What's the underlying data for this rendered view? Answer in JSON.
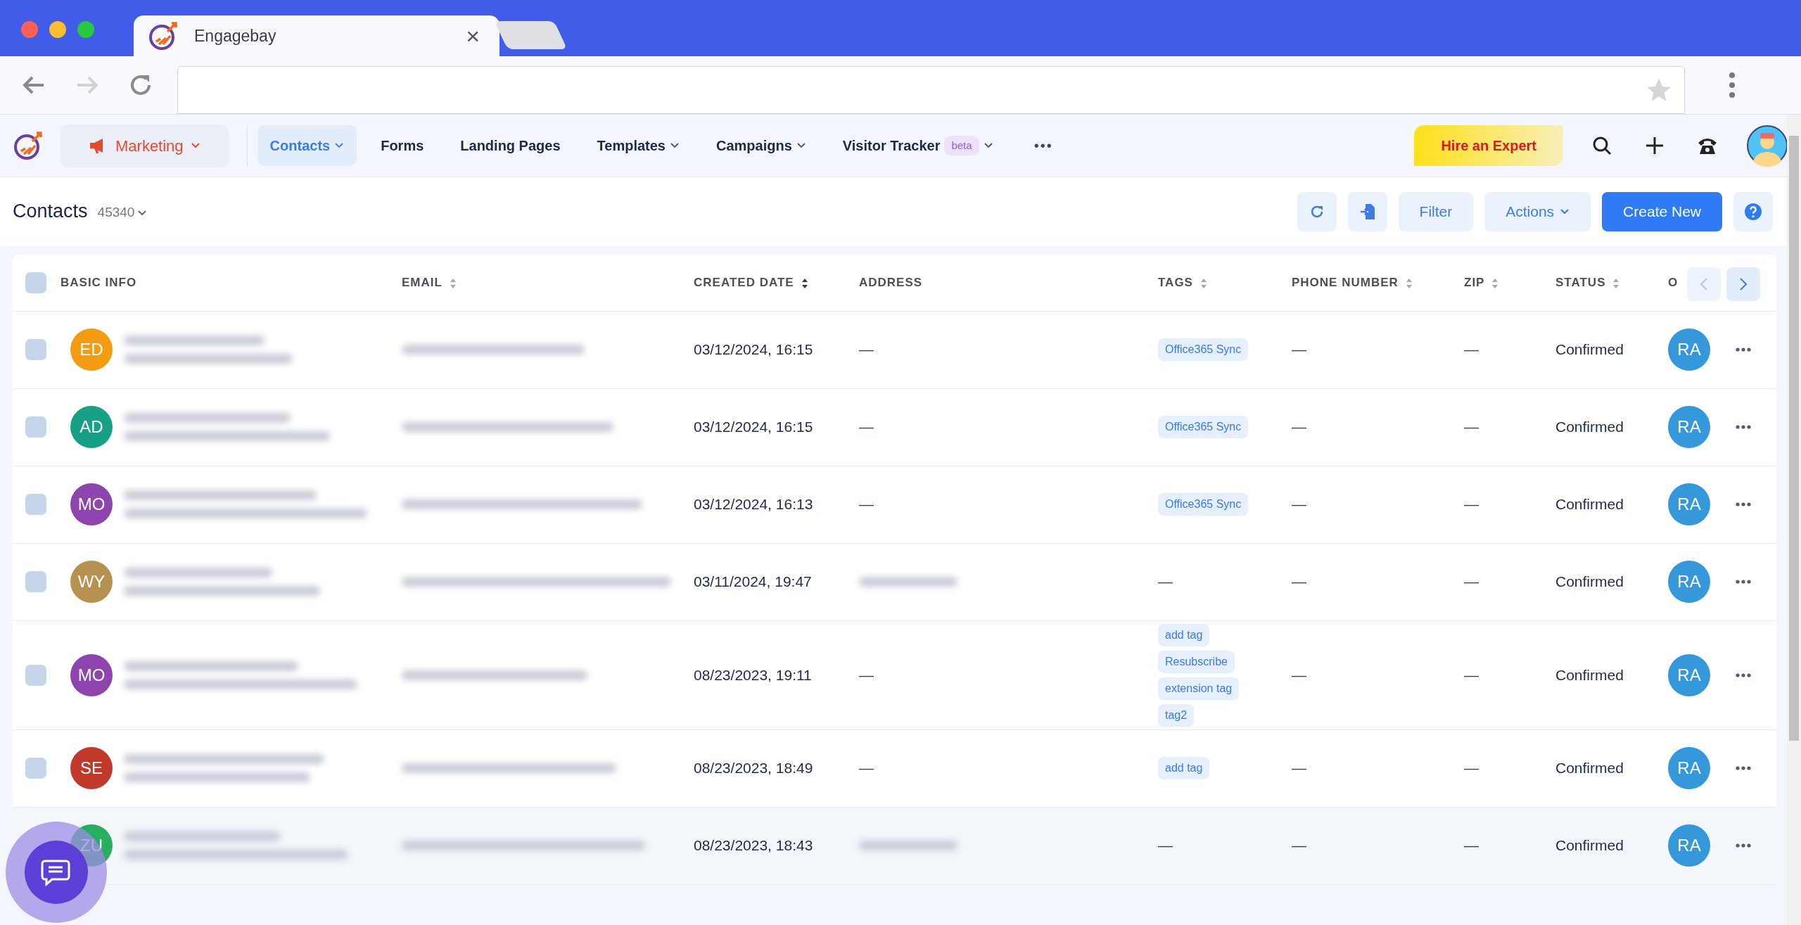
{
  "browser": {
    "tab_title": "Engagebay",
    "close": "×"
  },
  "app_nav": {
    "module": "Marketing",
    "items": [
      {
        "label": "Contacts",
        "selected": true,
        "dropdown": true
      },
      {
        "label": "Forms",
        "selected": false,
        "dropdown": false
      },
      {
        "label": "Landing Pages",
        "selected": false,
        "dropdown": false
      },
      {
        "label": "Templates",
        "selected": false,
        "dropdown": true
      },
      {
        "label": "Campaigns",
        "selected": false,
        "dropdown": true
      },
      {
        "label": "Visitor Tracker",
        "selected": false,
        "dropdown": true,
        "badge": "beta"
      }
    ],
    "more": "•••",
    "hire_button": "Hire an Expert"
  },
  "page": {
    "title": "Contacts",
    "count": "45340",
    "filter": "Filter",
    "actions": "Actions",
    "create": "Create New"
  },
  "table": {
    "select_all_checked": false,
    "columns": [
      {
        "label": "BASIC INFO",
        "sortable": false,
        "sorted": false
      },
      {
        "label": "EMAIL",
        "sortable": true,
        "sorted": false
      },
      {
        "label": "CREATED DATE",
        "sortable": true,
        "sorted": true
      },
      {
        "label": "ADDRESS",
        "sortable": false,
        "sorted": false
      },
      {
        "label": "TAGS",
        "sortable": true,
        "sorted": false
      },
      {
        "label": "PHONE NUMBER",
        "sortable": true,
        "sorted": false
      },
      {
        "label": "ZIP",
        "sortable": true,
        "sorted": false
      },
      {
        "label": "STATUS",
        "sortable": true,
        "sorted": false
      },
      {
        "label": "O",
        "sortable": false,
        "sorted": false
      }
    ],
    "rows": [
      {
        "checked": false,
        "highlighted": false,
        "initials": "ED",
        "color": "#f39c12",
        "created": "03/12/2024, 16:15",
        "address": "—",
        "address_blurred": false,
        "tags": [
          "Office365 Sync"
        ],
        "phone": "—",
        "zip": "—",
        "status": "Confirmed",
        "owner": "RA"
      },
      {
        "checked": false,
        "highlighted": false,
        "initials": "AD",
        "color": "#16a085",
        "created": "03/12/2024, 16:15",
        "address": "—",
        "address_blurred": false,
        "tags": [
          "Office365 Sync"
        ],
        "phone": "—",
        "zip": "—",
        "status": "Confirmed",
        "owner": "RA"
      },
      {
        "checked": false,
        "highlighted": false,
        "initials": "MO",
        "color": "#8e44ad",
        "created": "03/12/2024, 16:13",
        "address": "—",
        "address_blurred": false,
        "tags": [
          "Office365 Sync"
        ],
        "phone": "—",
        "zip": "—",
        "status": "Confirmed",
        "owner": "RA"
      },
      {
        "checked": false,
        "highlighted": false,
        "initials": "WY",
        "color": "#b7914f",
        "created": "03/11/2024, 19:47",
        "address_blurred": true,
        "tags_placeholder": "—",
        "phone": "—",
        "zip": "—",
        "status": "Confirmed",
        "owner": "RA"
      },
      {
        "checked": false,
        "highlighted": false,
        "initials": "MO",
        "color": "#8e44ad",
        "created": "08/23/2023, 19:11",
        "address": "—",
        "address_blurred": false,
        "tags": [
          "add tag",
          "Resubscribe",
          "extension tag",
          "tag2"
        ],
        "phone": "—",
        "zip": "—",
        "status": "Confirmed",
        "owner": "RA"
      },
      {
        "checked": false,
        "highlighted": false,
        "initials": "SE",
        "color": "#c0392b",
        "created": "08/23/2023, 18:49",
        "address": "—",
        "address_blurred": false,
        "tags": [
          "add tag"
        ],
        "phone": "—",
        "zip": "—",
        "status": "Confirmed",
        "owner": "RA"
      },
      {
        "highlighted": true,
        "initials": "ZU",
        "color": "#27ae60",
        "created": "08/23/2023, 18:43",
        "address_blurred": true,
        "tags_placeholder": "—",
        "phone": "—",
        "zip": "—",
        "status": "Confirmed",
        "owner": "RA"
      }
    ]
  }
}
